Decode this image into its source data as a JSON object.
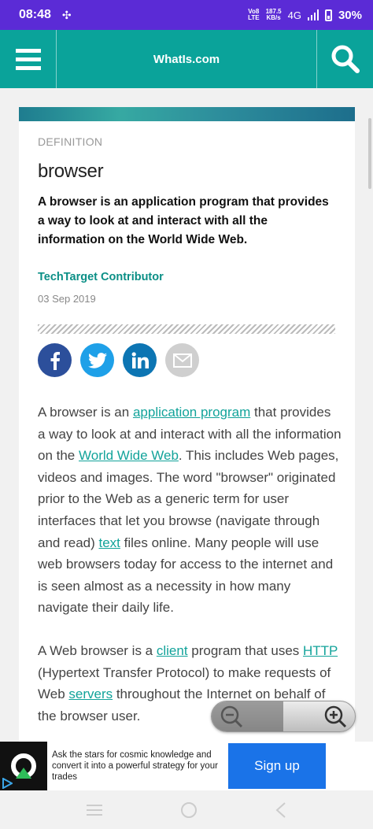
{
  "status_bar": {
    "time": "08:48",
    "network_top": "Vo8",
    "network_bottom": "LTE",
    "speed_top": "187.5",
    "speed_bottom": "KB/s",
    "signal": "4G",
    "battery": "30%"
  },
  "app_bar": {
    "title": "WhatIs.com"
  },
  "article": {
    "category": "DEFINITION",
    "term": "browser",
    "summary": "A browser is an application program that provides a way to look at and interact with all the information on the World Wide Web.",
    "author": "TechTarget Contributor",
    "date": "03 Sep 2019",
    "p1": {
      "t1": "A browser is an ",
      "l1": "application program",
      "t2": " that provides a way to look at and interact with all the information on the ",
      "l2": "World Wide Web",
      "t3": ". This includes Web pages, videos and images. The word \"browser\" originated prior to the Web as a generic term for user interfaces that let you browse (navigate through and read) ",
      "l3": "text",
      "t4": " files online. Many people will use web browsers today for access to the internet and is seen almost as a necessity in how many navigate their daily life."
    },
    "p2": {
      "t1": "A Web browser is a ",
      "l1": "client",
      "t2": " program that uses ",
      "l2": "HTTP",
      "t3": " (Hypertext Transfer Protocol) to make requests of Web ",
      "l3": "servers",
      "t4": " throughout the Internet on behalf of the browser user."
    }
  },
  "ad": {
    "text": "Ask the stars for cosmic knowledge and convert it into a powerful strategy for your trades",
    "button": "Sign up"
  },
  "colors": {
    "status_bar": "#5b2bd6",
    "app_bar": "#0aa39a",
    "link": "#12a39a",
    "ad_button": "#1a73e8"
  }
}
